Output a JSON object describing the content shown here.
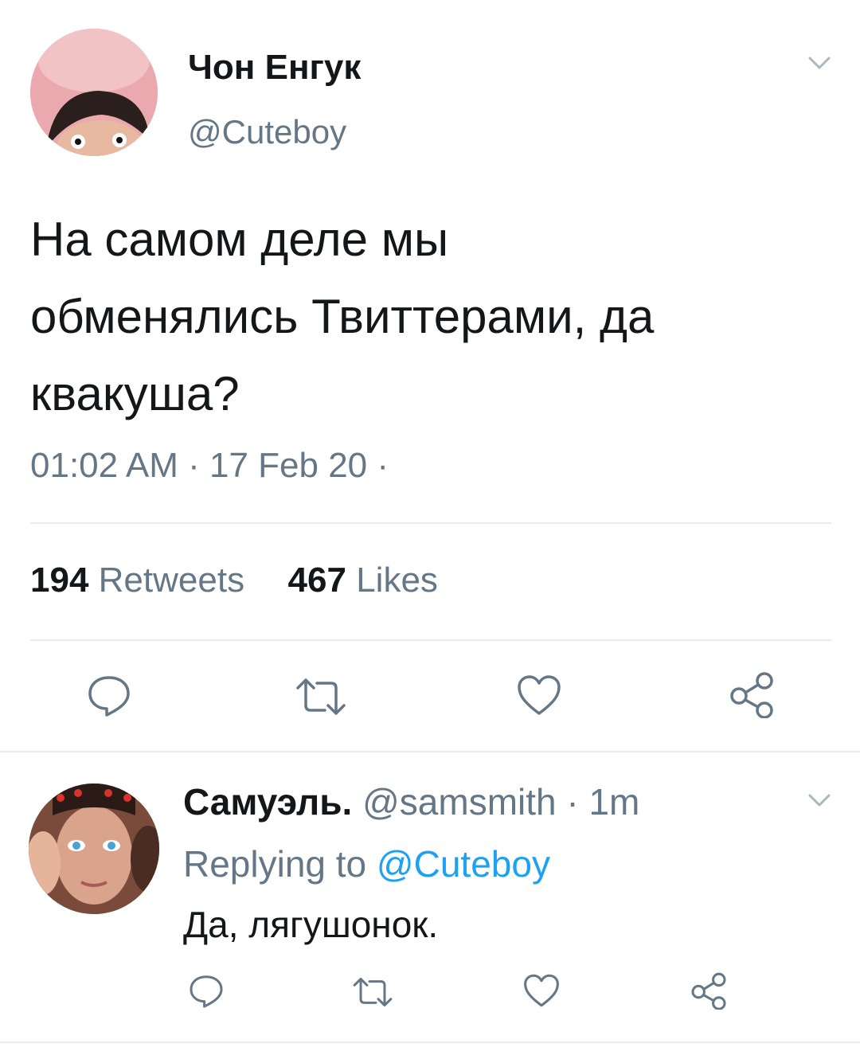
{
  "tweet": {
    "author_name": "Чон Енгук",
    "author_handle": "@Cuteboy",
    "text_lines": [
      "На самом деле мы",
      "обменялись Твиттерами, да",
      "квакуша?"
    ],
    "meta": "01:02 AM · 17 Feb 20 ·",
    "retweets_count": "194",
    "retweets_label": "Retweets",
    "likes_count": "467",
    "likes_label": "Likes"
  },
  "reply": {
    "author_name": "Самуэль.",
    "author_handle": "@samsmith",
    "time": "· 1m",
    "replying_prefix": "Replying to",
    "replying_to": "@Cuteboy",
    "text": "Да, лягушонок."
  },
  "icons": {
    "reply": "comment-bubble-icon",
    "retweet": "retweet-icon",
    "like": "heart-icon",
    "share": "share-icon",
    "menu": "chevron-down-icon"
  },
  "colors": {
    "text_primary": "#14171a",
    "text_secondary": "#657786",
    "link": "#1da1f2",
    "divider": "#e6ecf0"
  }
}
